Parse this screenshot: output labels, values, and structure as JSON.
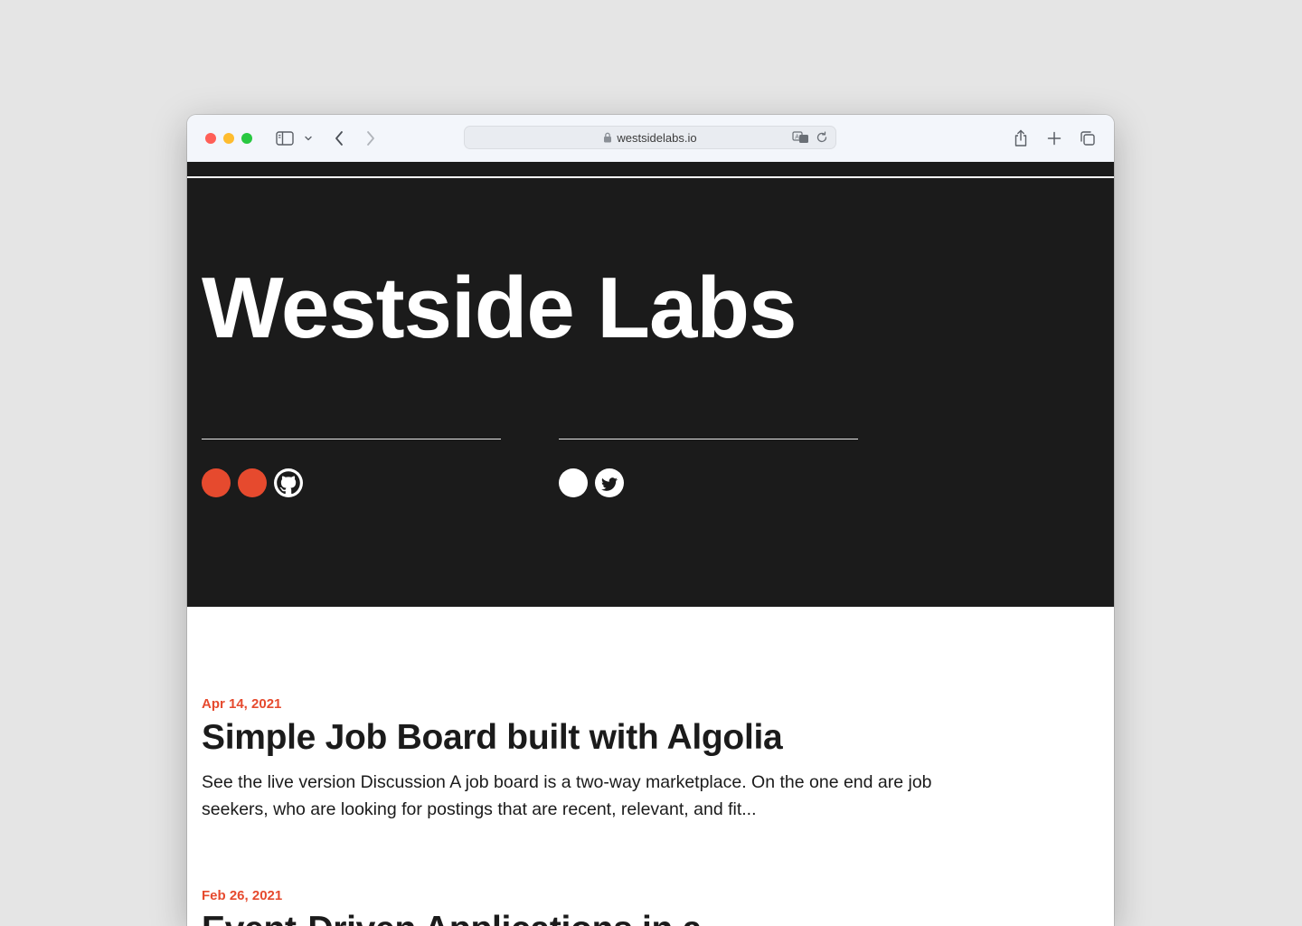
{
  "browser": {
    "url": "westsidelabs.io",
    "icons": [
      "sidebar-icon",
      "chevron-down-icon",
      "back-icon",
      "forward-icon",
      "lock-icon",
      "translate-icon",
      "reload-icon",
      "share-icon",
      "new-tab-icon",
      "tabs-overview-icon"
    ]
  },
  "hero": {
    "title": "Westside Labs",
    "social_group_1": [
      "circle",
      "circle",
      "github-icon"
    ],
    "social_group_2": [
      "circle",
      "twitter-icon"
    ]
  },
  "posts": [
    {
      "date": "Apr 14, 2021",
      "title": "Simple Job Board built with Algolia",
      "excerpt": "See the live version Discussion A job board is a two-way marketplace. On the one end are job seekers, who are looking for postings that are recent, relevant, and fit..."
    },
    {
      "date": "Feb 26, 2021",
      "title": "Event-Driven Applications in a"
    }
  ],
  "colors": {
    "accent": "#e64a2e",
    "hero_bg": "#1b1b1b",
    "text": "#1b1b1b"
  }
}
